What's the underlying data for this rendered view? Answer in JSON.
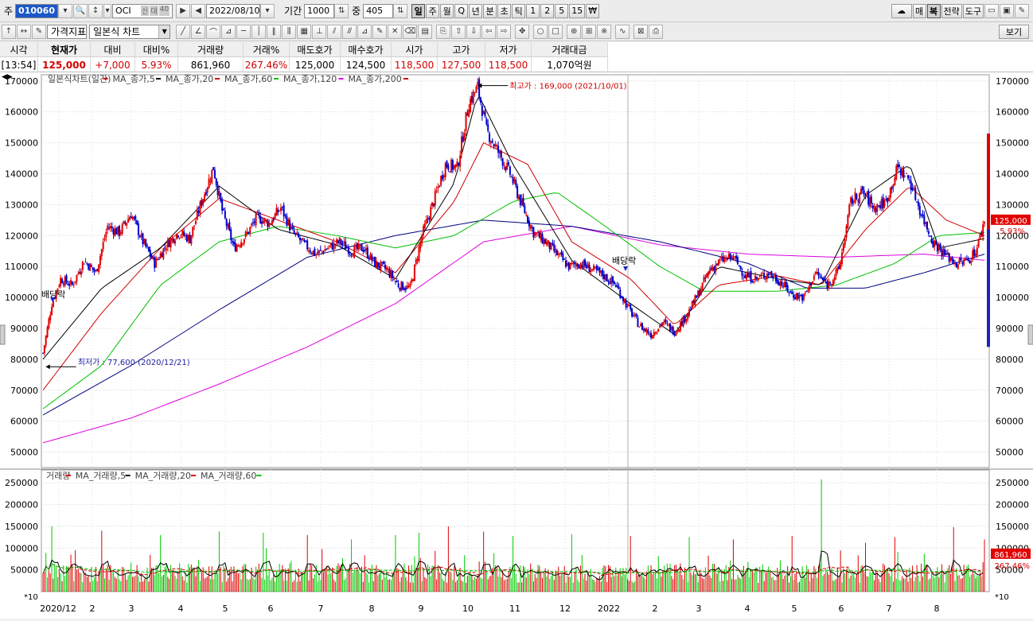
{
  "toolbar": {
    "stock_label": "주",
    "code": "010060",
    "name": "OCI",
    "badges": [
      "신",
      "대",
      "40"
    ],
    "date": "2022/08/10",
    "period_label": "기간",
    "period": "1000",
    "mid_label": "중",
    "mid_value": "405",
    "timeframes": [
      "일",
      "주",
      "월",
      "Q",
      "년",
      "분",
      "초",
      "틱",
      "1",
      "2",
      "5",
      "15",
      "₩"
    ],
    "active_timeframe": "일",
    "right_buttons": [
      "매",
      "복",
      "전략",
      "도구"
    ],
    "indicator_combo": "가격지표",
    "chart_type_combo": "일본식 차트",
    "view_button": "보기"
  },
  "quote": {
    "headers": [
      "시각",
      "현재가",
      "대비",
      "대비%",
      "거래량",
      "거래%",
      "매도호가",
      "매수호가",
      "시가",
      "고가",
      "저가",
      "거래대금"
    ],
    "values": [
      "[13:54]",
      "125,000",
      "+7,000",
      "5.93%",
      "861,960",
      "267.46%",
      "125,000",
      "124,500",
      "118,500",
      "127,500",
      "118,500",
      "1,070억원"
    ]
  },
  "legend": {
    "price": [
      "일본식차트(일간)",
      "MA_종가,5",
      "MA_종가,20",
      "MA_종가,60",
      "MA_종가,120",
      "MA_종가,200"
    ],
    "volume": [
      "거래량",
      "MA_거래량,5",
      "MA_거래량,20",
      "MA_거래량,60"
    ]
  },
  "annotations": {
    "high": "최고가 : 169,000 (2021/10/01)",
    "low": "최저가 : 77,600 (2020/12/21)",
    "dividend1": "배당락",
    "dividend2": "배당락",
    "last_price": "125,000",
    "last_pct": "5.93%",
    "last_volume": "861,960",
    "last_vol_pct": "267.46%",
    "vol_scale": "*10"
  },
  "colors": {
    "up": "#e00000",
    "down": "#0000cc",
    "ma5": "#000000",
    "ma20": "#d00000",
    "ma60": "#00c000",
    "ma120": "#000080",
    "ma200": "#e000e0"
  },
  "chart_data": {
    "type": "candlestick",
    "price_axis_ticks": [
      "170000",
      "160000",
      "150000",
      "140000",
      "130000",
      "120000",
      "110000",
      "100000",
      "90000",
      "80000",
      "70000",
      "60000",
      "50000"
    ],
    "volume_axis_ticks": [
      "250000",
      "200000",
      "150000",
      "100000",
      "50000"
    ],
    "x_ticks": [
      "2020/12",
      "2",
      "3",
      "4",
      "5",
      "6",
      "7",
      "8",
      "9",
      "10",
      "11",
      "12",
      "2022",
      "2",
      "3",
      "4",
      "5",
      "6",
      "7",
      "8"
    ],
    "ylim": [
      45000,
      172000
    ],
    "volume_ylim": [
      0,
      265000
    ],
    "price_path": [
      [
        0,
        82000
      ],
      [
        6,
        98000
      ],
      [
        12,
        106000
      ],
      [
        20,
        104000
      ],
      [
        28,
        112000
      ],
      [
        36,
        108000
      ],
      [
        44,
        123000
      ],
      [
        52,
        121000
      ],
      [
        60,
        127000
      ],
      [
        68,
        118000
      ],
      [
        76,
        111000
      ],
      [
        84,
        117000
      ],
      [
        92,
        121000
      ],
      [
        100,
        119000
      ],
      [
        108,
        131000
      ],
      [
        116,
        142000
      ],
      [
        122,
        128000
      ],
      [
        130,
        116000
      ],
      [
        138,
        120000
      ],
      [
        146,
        126000
      ],
      [
        154,
        124000
      ],
      [
        162,
        129000
      ],
      [
        170,
        121000
      ],
      [
        178,
        117000
      ],
      [
        186,
        114000
      ],
      [
        194,
        116000
      ],
      [
        202,
        118000
      ],
      [
        210,
        115000
      ],
      [
        218,
        116000
      ],
      [
        226,
        111000
      ],
      [
        234,
        109000
      ],
      [
        242,
        104000
      ],
      [
        250,
        103000
      ],
      [
        258,
        120000
      ],
      [
        266,
        131000
      ],
      [
        274,
        143000
      ],
      [
        282,
        142000
      ],
      [
        290,
        163000
      ],
      [
        296,
        168000
      ],
      [
        302,
        154000
      ],
      [
        310,
        147000
      ],
      [
        318,
        140000
      ],
      [
        326,
        130000
      ],
      [
        334,
        121000
      ],
      [
        342,
        118000
      ],
      [
        350,
        114000
      ],
      [
        358,
        110000
      ],
      [
        366,
        111000
      ],
      [
        374,
        109000
      ],
      [
        382,
        107000
      ],
      [
        390,
        104000
      ],
      [
        398,
        97000
      ],
      [
        406,
        91000
      ],
      [
        414,
        88000
      ],
      [
        422,
        92000
      ],
      [
        430,
        89000
      ],
      [
        438,
        94000
      ],
      [
        446,
        101000
      ],
      [
        454,
        109000
      ],
      [
        462,
        112000
      ],
      [
        470,
        113000
      ],
      [
        478,
        107000
      ],
      [
        486,
        106000
      ],
      [
        494,
        108000
      ],
      [
        502,
        105000
      ],
      [
        510,
        101000
      ],
      [
        518,
        100000
      ],
      [
        526,
        108000
      ],
      [
        534,
        104000
      ],
      [
        542,
        109000
      ],
      [
        550,
        131000
      ],
      [
        558,
        134000
      ],
      [
        566,
        129000
      ],
      [
        574,
        131000
      ],
      [
        582,
        142000
      ],
      [
        590,
        138000
      ],
      [
        598,
        127000
      ],
      [
        606,
        118000
      ],
      [
        614,
        114000
      ],
      [
        622,
        111000
      ],
      [
        630,
        112000
      ],
      [
        636,
        116000
      ],
      [
        641,
        125000
      ]
    ],
    "ma5": [
      [
        0,
        80000
      ],
      [
        40,
        103000
      ],
      [
        80,
        116000
      ],
      [
        120,
        136000
      ],
      [
        160,
        122000
      ],
      [
        200,
        117000
      ],
      [
        240,
        106000
      ],
      [
        280,
        137000
      ],
      [
        296,
        166000
      ],
      [
        320,
        143000
      ],
      [
        360,
        112000
      ],
      [
        400,
        98000
      ],
      [
        430,
        88000
      ],
      [
        460,
        110000
      ],
      [
        500,
        106000
      ],
      [
        530,
        104000
      ],
      [
        560,
        133000
      ],
      [
        590,
        143000
      ],
      [
        610,
        116000
      ],
      [
        641,
        119000
      ]
    ],
    "ma20": [
      [
        0,
        70000
      ],
      [
        40,
        95000
      ],
      [
        80,
        116000
      ],
      [
        120,
        132000
      ],
      [
        160,
        125000
      ],
      [
        200,
        118000
      ],
      [
        240,
        108000
      ],
      [
        280,
        131000
      ],
      [
        300,
        150000
      ],
      [
        330,
        143000
      ],
      [
        360,
        118000
      ],
      [
        400,
        106000
      ],
      [
        430,
        91000
      ],
      [
        460,
        104000
      ],
      [
        500,
        107000
      ],
      [
        530,
        104000
      ],
      [
        560,
        122000
      ],
      [
        590,
        136000
      ],
      [
        615,
        125000
      ],
      [
        641,
        120000
      ]
    ],
    "ma60": [
      [
        0,
        64000
      ],
      [
        40,
        78000
      ],
      [
        80,
        104000
      ],
      [
        120,
        118000
      ],
      [
        160,
        123000
      ],
      [
        200,
        120000
      ],
      [
        240,
        116000
      ],
      [
        280,
        120000
      ],
      [
        320,
        131000
      ],
      [
        350,
        134000
      ],
      [
        380,
        124000
      ],
      [
        420,
        110000
      ],
      [
        450,
        102000
      ],
      [
        500,
        102000
      ],
      [
        540,
        104000
      ],
      [
        580,
        111000
      ],
      [
        610,
        120000
      ],
      [
        641,
        121000
      ]
    ],
    "ma120": [
      [
        0,
        62000
      ],
      [
        60,
        78000
      ],
      [
        120,
        96000
      ],
      [
        180,
        113000
      ],
      [
        240,
        120000
      ],
      [
        300,
        125000
      ],
      [
        360,
        123000
      ],
      [
        420,
        118000
      ],
      [
        480,
        111000
      ],
      [
        520,
        103000
      ],
      [
        560,
        103000
      ],
      [
        600,
        108000
      ],
      [
        641,
        114000
      ]
    ],
    "ma200": [
      [
        0,
        53000
      ],
      [
        60,
        61000
      ],
      [
        120,
        72000
      ],
      [
        180,
        84000
      ],
      [
        240,
        98000
      ],
      [
        300,
        118000
      ],
      [
        360,
        123000
      ],
      [
        420,
        117000
      ],
      [
        480,
        114000
      ],
      [
        540,
        113000
      ],
      [
        600,
        114000
      ],
      [
        641,
        112000
      ]
    ],
    "volume_spikes": [
      [
        6,
        150000
      ],
      [
        40,
        140000
      ],
      [
        80,
        130000
      ],
      [
        120,
        138000
      ],
      [
        150,
        135000
      ],
      [
        180,
        130000
      ],
      [
        210,
        120000
      ],
      [
        240,
        130000
      ],
      [
        256,
        135000
      ],
      [
        276,
        150000
      ],
      [
        300,
        138000
      ],
      [
        320,
        128000
      ],
      [
        360,
        132000
      ],
      [
        400,
        128000
      ],
      [
        440,
        125000
      ],
      [
        470,
        120000
      ],
      [
        510,
        128000
      ],
      [
        530,
        258000
      ],
      [
        560,
        112000
      ],
      [
        580,
        125000
      ],
      [
        620,
        148000
      ],
      [
        641,
        120000
      ]
    ]
  }
}
